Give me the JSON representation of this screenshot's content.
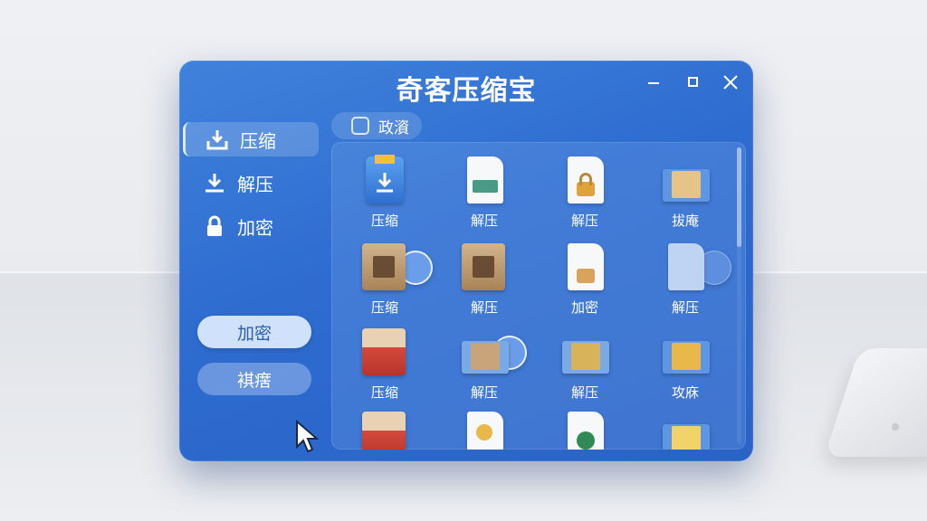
{
  "window": {
    "title": "奇客压缩宝",
    "controls": [
      "minimize",
      "maximize",
      "close"
    ]
  },
  "sidebar": {
    "items": [
      {
        "label": "压缩",
        "icon": "download-tray-icon",
        "active": true
      },
      {
        "label": "解压",
        "icon": "download-arrow-icon",
        "active": false
      },
      {
        "label": "加密",
        "icon": "lock-icon",
        "active": false
      }
    ],
    "buttons": [
      {
        "label": "加密"
      },
      {
        "label": "褀瘔"
      }
    ]
  },
  "toolbar": {
    "breadcrumb": "政澬"
  },
  "grid": {
    "tiles": [
      {
        "label": "压缩",
        "icon": "compress-download-icon"
      },
      {
        "label": "解压",
        "icon": "document-tray-icon"
      },
      {
        "label": "解压",
        "icon": "document-lock-icon"
      },
      {
        "label": "拔庵",
        "icon": "envelope-folder-icon"
      },
      {
        "label": "压缩",
        "icon": "archive-box-icon"
      },
      {
        "label": "解压",
        "icon": "archive-box-icon"
      },
      {
        "label": "加密",
        "icon": "document-lock-icon"
      },
      {
        "label": "解压",
        "icon": "document-folder-icon"
      },
      {
        "label": "压缩",
        "icon": "red-archive-icon"
      },
      {
        "label": "解压",
        "icon": "envelope-box-icon"
      },
      {
        "label": "解压",
        "icon": "envelope-image-icon"
      },
      {
        "label": "攻庥",
        "icon": "envelope-gold-icon"
      },
      {
        "label": "",
        "icon": "red-archive-icon"
      },
      {
        "label": "",
        "icon": "document-cone-icon"
      },
      {
        "label": "",
        "icon": "document-green-icon"
      },
      {
        "label": "",
        "icon": "envelope-folder-icon"
      }
    ]
  },
  "colors": {
    "window_blue": "#2e6cd0",
    "pill_active": "#cfe1fb",
    "text": "#ffffff"
  }
}
